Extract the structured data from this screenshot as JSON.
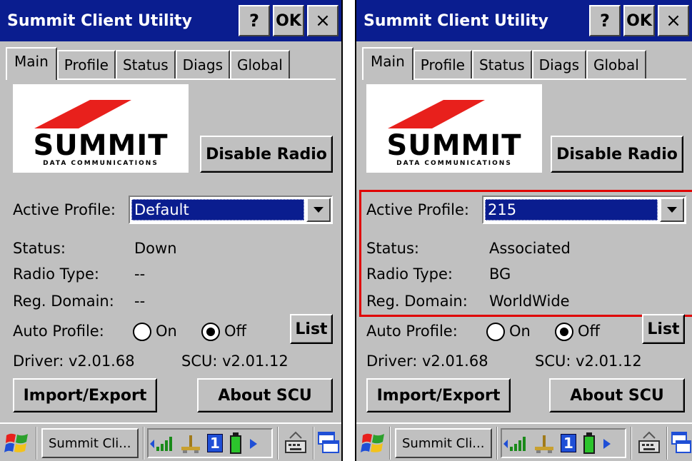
{
  "screens": [
    {
      "title": "Summit Client Utility",
      "title_buttons": {
        "help": "?",
        "ok": "OK",
        "close": "×"
      },
      "tabs": [
        "Main",
        "Profile",
        "Status",
        "Diags",
        "Global"
      ],
      "logo": {
        "word": "SUMMIT",
        "sub": "DATA COMMUNICATIONS"
      },
      "disable_radio": "Disable Radio",
      "active_profile_label": "Active Profile:",
      "active_profile_value": "Default",
      "status_label": "Status:",
      "status_value": "Down",
      "radio_type_label": "Radio Type:",
      "radio_type_value": "--",
      "reg_domain_label": "Reg. Domain:",
      "reg_domain_value": "--",
      "auto_profile_label": "Auto Profile:",
      "radio_on": "On",
      "radio_off": "Off",
      "auto_profile_selected": "Off",
      "list_button": "List",
      "driver": "Driver:  v2.01.68",
      "scu": "SCU: v2.01.12",
      "import_export": "Import/Export",
      "about": "About SCU",
      "taskbar": {
        "task": "Summit Cli...",
        "tray_number": "1"
      }
    },
    {
      "title": "Summit Client Utility",
      "title_buttons": {
        "help": "?",
        "ok": "OK",
        "close": "×"
      },
      "tabs": [
        "Main",
        "Profile",
        "Status",
        "Diags",
        "Global"
      ],
      "logo": {
        "word": "SUMMIT",
        "sub": "DATA COMMUNICATIONS"
      },
      "disable_radio": "Disable Radio",
      "active_profile_label": "Active Profile:",
      "active_profile_value": "215",
      "status_label": "Status:",
      "status_value": "Associated",
      "radio_type_label": "Radio Type:",
      "radio_type_value": "BG",
      "reg_domain_label": "Reg. Domain:",
      "reg_domain_value": "WorldWide",
      "auto_profile_label": "Auto Profile:",
      "radio_on": "On",
      "radio_off": "Off",
      "auto_profile_selected": "Off",
      "list_button": "List",
      "driver": "Driver:  v2.01.68",
      "scu": "SCU: v2.01.12",
      "import_export": "Import/Export",
      "about": "About SCU",
      "taskbar": {
        "task": "Summit Cli...",
        "tray_number": "1"
      }
    }
  ],
  "colors": {
    "titlebar": "#0a1d8f",
    "face": "#c0c0c0",
    "logo_red": "#e8201c",
    "highlight": "#e00000"
  }
}
